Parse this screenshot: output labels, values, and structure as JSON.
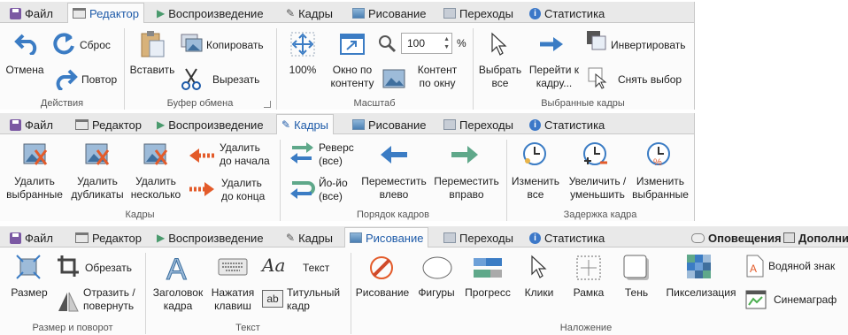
{
  "tabs": {
    "file": "Файл",
    "editor": "Редактор",
    "playback": "Воспроизведение",
    "frames": "Кадры",
    "drawing": "Рисование",
    "transitions": "Переходы",
    "stats": "Статистика"
  },
  "extra_tabs": {
    "notifications": "Оповещения",
    "more": "Дополни"
  },
  "band1": {
    "groups": {
      "actions": "Действия",
      "clipboard": "Буфер обмена",
      "zoom": "Масштаб",
      "selected": "Выбранные кадры"
    },
    "undo": "Отмена",
    "reset": "Сброс",
    "redo": "Повтор",
    "paste": "Вставить",
    "copy": "Копировать",
    "cut": "Вырезать",
    "zoom100": "100%",
    "fit_window_1": "Окно по",
    "fit_window_2": "контенту",
    "fit_content_1": "Контент",
    "fit_content_2": "по окну",
    "zoom_value": "100",
    "zoom_unit": "%",
    "select_all_1": "Выбрать",
    "select_all_2": "все",
    "goto_1": "Перейти к",
    "goto_2": "кадру...",
    "invert": "Инвертировать",
    "deselect": "Снять выбор"
  },
  "band2": {
    "groups": {
      "frames": "Кадры",
      "order": "Порядок кадров",
      "delay": "Задержка кадра"
    },
    "del_sel_1": "Удалить",
    "del_sel_2": "выбранные",
    "del_dup_1": "Удалить",
    "del_dup_2": "дубликаты",
    "del_sev_1": "Удалить",
    "del_sev_2": "несколько",
    "del_start_1": "Удалить",
    "del_start_2": "до начала",
    "del_end_1": "Удалить",
    "del_end_2": "до конца",
    "reverse_1": "Реверс",
    "reverse_2": "(все)",
    "yoyo_1": "Йо-йо",
    "yoyo_2": "(все)",
    "move_left_1": "Переместить",
    "move_left_2": "влево",
    "move_right_1": "Переместить",
    "move_right_2": "вправо",
    "change_all_1": "Изменить",
    "change_all_2": "все",
    "incdec_1": "Увеличить /",
    "incdec_2": "уменьшить",
    "change_sel_1": "Изменить",
    "change_sel_2": "выбранные"
  },
  "band3": {
    "groups": {
      "size_rotate": "Размер и поворот",
      "text": "Текст",
      "overlay": "Наложение"
    },
    "resize": "Размер",
    "crop": "Обрезать",
    "flip_1": "Отразить /",
    "flip_2": "повернуть",
    "title_frame_1": "Заголовок",
    "title_frame_2": "кадра",
    "keys_1": "Нажатия",
    "keys_2": "клавиш",
    "text": "Текст",
    "caption_1": "Титульный",
    "caption_2": "кадр",
    "free_draw": "Рисование",
    "shapes": "Фигуры",
    "progress": "Прогресс",
    "clicks": "Клики",
    "border": "Рамка",
    "shadow": "Тень",
    "pixelate": "Пикселизация",
    "watermark": "Водяной знак",
    "cinemagraph": "Синемаграф"
  },
  "colors": {
    "accent": "#1d5aa8",
    "arrow_blue": "#3b7cc4",
    "arrow_orange": "#e35b2a",
    "arrow_green": "#5fa88a"
  }
}
